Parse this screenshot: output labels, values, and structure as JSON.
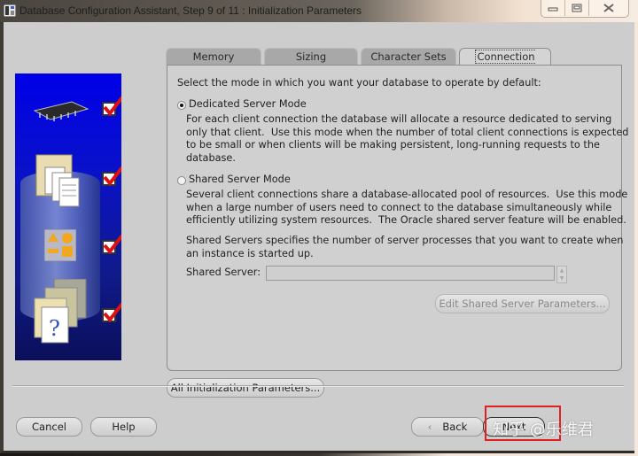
{
  "window": {
    "title": "Database Configuration Assistant, Step 9 of 11 : Initialization Parameters",
    "controls": {
      "minimize_icon": "minimize-icon",
      "maximize_icon": "maximize-icon",
      "close_icon": "close-icon"
    }
  },
  "sidebar": {
    "steps": [
      {
        "icon": "memory-chip-icon",
        "checked": true
      },
      {
        "icon": "documents-folder-icon",
        "checked": true
      },
      {
        "icon": "shapes-icon",
        "checked": true
      },
      {
        "icon": "help-document-icon",
        "checked": true
      }
    ]
  },
  "tabs": [
    {
      "label": "Memory",
      "active": false
    },
    {
      "label": "Sizing",
      "active": false
    },
    {
      "label": "Character Sets",
      "active": false
    },
    {
      "label": "Connection Mode",
      "active": true
    }
  ],
  "panel": {
    "intro": "Select the mode in which you want your database to operate by default:",
    "dedicated": {
      "label": "Dedicated Server Mode",
      "selected": true,
      "description": "For each client connection the database will allocate a resource dedicated to serving\nonly that client.  Use this mode when the number of total client connections is expected\nto be small or when clients will be making persistent, long-running requests to the\ndatabase."
    },
    "shared": {
      "label": "Shared Server Mode",
      "selected": false,
      "description": "Several client connections share a database-allocated pool of resources.  Use this mode\nwhen a large number of users need to connect to the database simultaneously while\nefficiently utilizing system resources.  The Oracle shared server feature will be enabled.",
      "servers_note": "Shared Servers specifies the number of server processes that you want to create when\nan instance is started up.",
      "field_label": "Shared Server:",
      "field_value": "",
      "edit_button": "Edit Shared Server Parameters..."
    }
  },
  "all_params_button": "All Initialization Parameters...",
  "footer": {
    "cancel": "Cancel",
    "help": "Help",
    "back": "Back",
    "next": "Next"
  },
  "overlay": {
    "watermark": "知乎 @乐维君",
    "highlight_color": "#e02020"
  }
}
